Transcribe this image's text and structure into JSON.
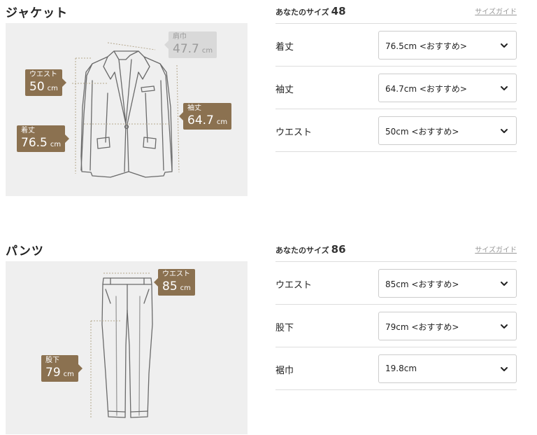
{
  "jacket": {
    "title": "ジャケット",
    "size_label": "あなたのサイズ",
    "size_value": "48",
    "size_guide": "サイズガイド",
    "callouts": {
      "shoulder": {
        "label": "肩巾",
        "value": "47.7",
        "unit": "cm"
      },
      "waist": {
        "label": "ウエスト",
        "value": "50",
        "unit": "cm"
      },
      "sleeve": {
        "label": "袖丈",
        "value": "64.7",
        "unit": "cm"
      },
      "length": {
        "label": "着丈",
        "value": "76.5",
        "unit": "cm"
      }
    },
    "rows": [
      {
        "label": "着丈",
        "value": "76.5cm <おすすめ>"
      },
      {
        "label": "袖丈",
        "value": "64.7cm <おすすめ>"
      },
      {
        "label": "ウエスト",
        "value": "50cm <おすすめ>"
      }
    ]
  },
  "pants": {
    "title": "パンツ",
    "size_label": "あなたのサイズ",
    "size_value": "86",
    "size_guide": "サイズガイド",
    "callouts": {
      "waist": {
        "label": "ウエスト",
        "value": "85",
        "unit": "cm"
      },
      "inseam": {
        "label": "股下",
        "value": "79",
        "unit": "cm"
      }
    },
    "rows": [
      {
        "label": "ウエスト",
        "value": "85cm <おすすめ>"
      },
      {
        "label": "股下",
        "value": "79cm <おすすめ>"
      },
      {
        "label": "裾巾",
        "value": "19.8cm"
      }
    ]
  },
  "icons": {
    "select_arrow": "chevron-down-icon"
  },
  "colors": {
    "accent": "#8b7150",
    "muted_callout": "#d9d9d9",
    "figure_bg": "#efefef"
  }
}
